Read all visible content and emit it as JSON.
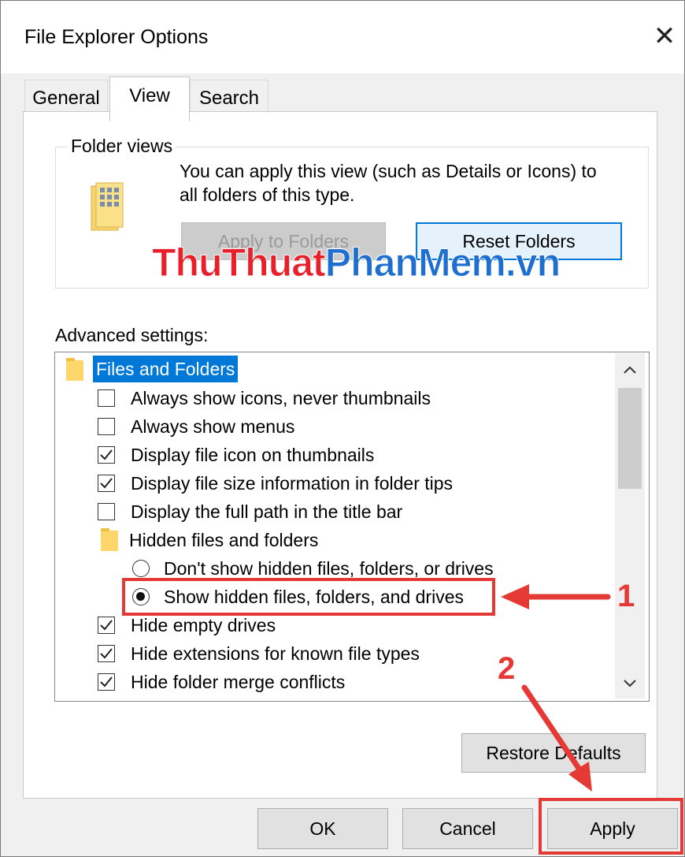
{
  "window": {
    "title": "File Explorer Options",
    "close_glyph": "✕"
  },
  "tabs": [
    {
      "label": "General",
      "active": false
    },
    {
      "label": "View",
      "active": true
    },
    {
      "label": "Search",
      "active": false
    }
  ],
  "folder_views": {
    "legend": "Folder views",
    "description_line1": "You can apply this view (such as Details or Icons) to",
    "description_line2": "all folders of this type.",
    "apply_button": "Apply to Folders",
    "reset_button": "Reset Folders"
  },
  "watermark": {
    "part1": "ThuThuat",
    "part2": "PhanMem",
    "part3": ".vn"
  },
  "advanced": {
    "label": "Advanced settings:",
    "items": [
      {
        "type": "folder",
        "label": "Files and Folders",
        "selected": true
      },
      {
        "type": "checkbox",
        "label": "Always show icons, never thumbnails",
        "checked": false
      },
      {
        "type": "checkbox",
        "label": "Always show menus",
        "checked": false
      },
      {
        "type": "checkbox",
        "label": "Display file icon on thumbnails",
        "checked": true
      },
      {
        "type": "checkbox",
        "label": "Display file size information in folder tips",
        "checked": true
      },
      {
        "type": "checkbox",
        "label": "Display the full path in the title bar",
        "checked": false
      },
      {
        "type": "folder",
        "label": "Hidden files and folders",
        "selected": false
      },
      {
        "type": "radio",
        "label": "Don't show hidden files, folders, or drives",
        "checked": false
      },
      {
        "type": "radio",
        "label": "Show hidden files, folders, and drives",
        "checked": true
      },
      {
        "type": "checkbox",
        "label": "Hide empty drives",
        "checked": true
      },
      {
        "type": "checkbox",
        "label": "Hide extensions for known file types",
        "checked": true
      },
      {
        "type": "checkbox",
        "label": "Hide folder merge conflicts",
        "checked": true
      }
    ],
    "restore_button": "Restore Defaults"
  },
  "footer": {
    "ok": "OK",
    "cancel": "Cancel",
    "apply": "Apply"
  },
  "annotations": {
    "step1": "1",
    "step2": "2"
  },
  "colors": {
    "accent": "#0078d7",
    "annotation_red": "#e53935",
    "selection": "#0078d7",
    "watermark_red": "#e8202a",
    "watermark_blue": "#1f6fd1"
  }
}
